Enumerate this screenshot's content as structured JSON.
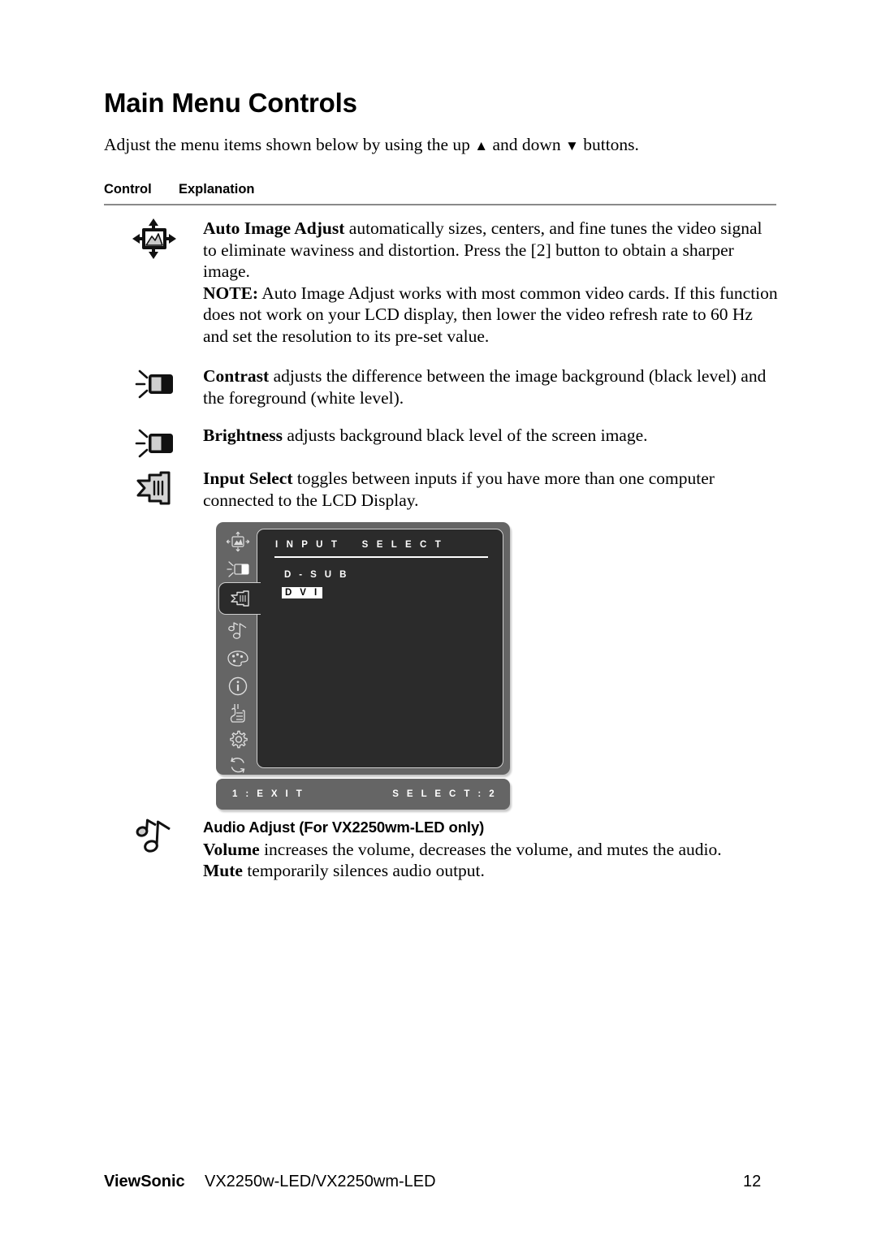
{
  "document": {
    "title": "Main Menu Controls",
    "intro_before": "Adjust the menu items shown below by using the up ",
    "intro_up_glyph": "▲",
    "intro_middle": " and down ",
    "intro_down_glyph": "▼",
    "intro_after": " buttons."
  },
  "table": {
    "header_control": "Control",
    "header_explanation": "Explanation"
  },
  "rows": {
    "auto_image_adjust": {
      "term": "Auto Image Adjust",
      "body": " automatically sizes, centers, and fine tunes the video signal to eliminate waviness and distortion. Press the [2] button to obtain a sharper image.",
      "note_label": "NOTE:",
      "note_body": " Auto Image Adjust works with most common video cards. If this function does not work on your LCD display, then lower the video refresh rate to 60 Hz and set the resolution to its pre-set value."
    },
    "contrast": {
      "term": "Contrast",
      "body": " adjusts the difference between the image background (black level) and the foreground (white level)."
    },
    "brightness": {
      "term": "Brightness",
      "body": " adjusts background black level of the screen image."
    },
    "input_select": {
      "term": "Input Select",
      "body": " toggles between inputs if you have more than one computer connected to the LCD Display."
    },
    "audio_adjust": {
      "title": "Audio Adjust (For VX2250wm-LED only)",
      "volume_term": "Volume",
      "volume_body": " increases the volume, decreases the volume, and mutes the audio.",
      "mute_term": "Mute",
      "mute_body": " temporarily silences audio output."
    }
  },
  "osd": {
    "heading": "I N P U T    S E L E C T",
    "items": [
      {
        "label": "D - S U B",
        "selected": false
      },
      {
        "label": "D V I",
        "selected": true
      }
    ],
    "footer_left": "1 : E X I T",
    "footer_right": "S E L E C T : 2",
    "sidebar_icons": [
      "auto-image-adjust-icon",
      "contrast-brightness-icon",
      "input-select-icon",
      "audio-adjust-icon",
      "color-adjust-icon",
      "information-icon",
      "manual-image-adjust-icon",
      "setup-menu-icon",
      "memory-recall-icon"
    ],
    "colors": {
      "sidebar_bg": "#656565",
      "panel_bg": "#2b2b2b",
      "panel_border": "#cfcfcf",
      "text": "#ffffff",
      "highlight_bg": "#ffffff",
      "highlight_text": "#000000"
    }
  },
  "footer": {
    "brand": "ViewSonic",
    "model": "VX2250w-LED/VX2250wm-LED",
    "page_number": "12"
  }
}
